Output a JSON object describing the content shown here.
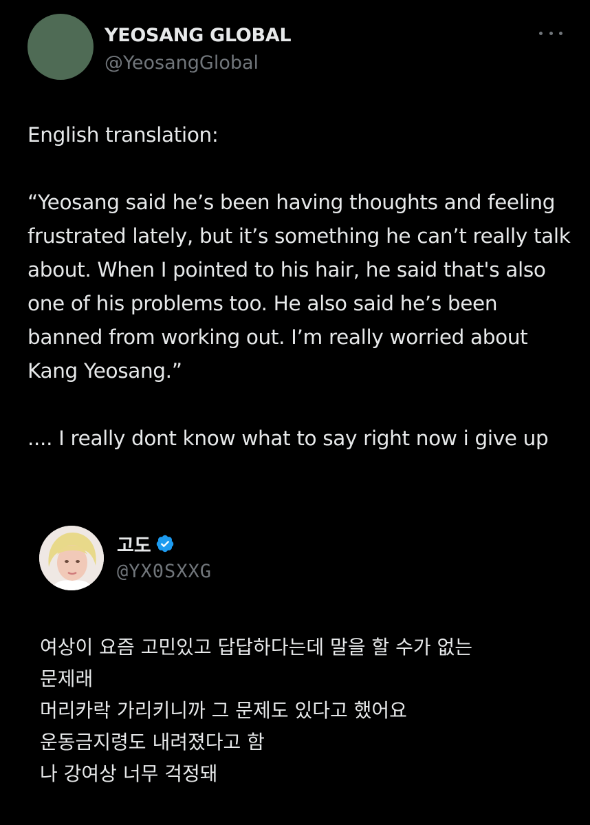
{
  "tweet": {
    "author_name": "YEOSANG GLOBAL",
    "author_handle": "@YeosangGlobal",
    "avatar_color": "#4f6b55",
    "more_icon": "more-horizontal-icon",
    "text": "English translation:\n\n“Yeosang said he’s been having thoughts and feeling frustrated lately, but it’s something he can’t really talk about. When I pointed to his hair, he said that's also one of his problems too. He also said he’s been banned from working out. I’m really worried about Kang Yeosang.”\n\n.... I really dont know what to say right now i give up"
  },
  "quoted_tweet": {
    "author_name": "고도",
    "verified_icon": "verified-badge-icon",
    "verified_color": "#1d9bf0",
    "author_handle": "@YX0SXXG",
    "text": "여상이 요즘 고민있고 답답하다는데 말을 할 수가 없는\n문제래\n머리카락 가리키니까 그 문제도 있다고 했어요\n운동금지령도 내려졌다고 함\n나 강여상 너무 걱정돼"
  },
  "colors": {
    "background": "#000000",
    "primary_text": "#e7e9ea",
    "secondary_text": "#71767b"
  }
}
